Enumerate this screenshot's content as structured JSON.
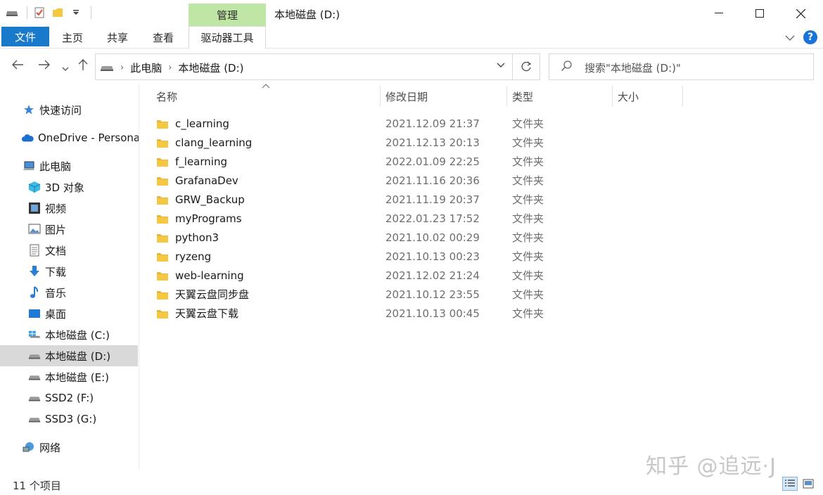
{
  "window": {
    "title": "本地磁盘 (D:)",
    "context_tab": "管理"
  },
  "ribbon": {
    "file": "文件",
    "home": "主页",
    "share": "共享",
    "view": "查看",
    "drive_tools": "驱动器工具"
  },
  "address": {
    "crumb1": "此电脑",
    "crumb2": "本地磁盘 (D:)"
  },
  "search": {
    "placeholder": "搜索\"本地磁盘 (D:)\""
  },
  "sidebar": {
    "items": [
      {
        "label": "快速访问",
        "icon": "star-icon"
      },
      {
        "label": "OneDrive - Personal",
        "icon": "cloud-icon"
      },
      {
        "label": "此电脑",
        "icon": "computer-icon"
      },
      {
        "label": "3D 对象",
        "icon": "cube-icon"
      },
      {
        "label": "视频",
        "icon": "film-icon"
      },
      {
        "label": "图片",
        "icon": "picture-icon"
      },
      {
        "label": "文档",
        "icon": "document-icon"
      },
      {
        "label": "下载",
        "icon": "download-icon"
      },
      {
        "label": "音乐",
        "icon": "music-icon"
      },
      {
        "label": "桌面",
        "icon": "desktop-icon"
      },
      {
        "label": "本地磁盘 (C:)",
        "icon": "windows-drive-icon"
      },
      {
        "label": "本地磁盘 (D:)",
        "icon": "drive-icon"
      },
      {
        "label": "本地磁盘 (E:)",
        "icon": "drive-icon"
      },
      {
        "label": "SSD2 (F:)",
        "icon": "drive-icon"
      },
      {
        "label": "SSD3 (G:)",
        "icon": "drive-icon"
      },
      {
        "label": "网络",
        "icon": "network-icon"
      }
    ]
  },
  "columns": {
    "name": "名称",
    "date": "修改日期",
    "type": "类型",
    "size": "大小"
  },
  "files": [
    {
      "name": "c_learning",
      "date": "2021.12.09 21:37",
      "type": "文件夹"
    },
    {
      "name": "clang_learning",
      "date": "2021.12.13 20:13",
      "type": "文件夹"
    },
    {
      "name": "f_learning",
      "date": "2022.01.09 22:25",
      "type": "文件夹"
    },
    {
      "name": "GrafanaDev",
      "date": "2021.11.16 20:36",
      "type": "文件夹"
    },
    {
      "name": "GRW_Backup",
      "date": "2021.11.19 20:37",
      "type": "文件夹"
    },
    {
      "name": "myPrograms",
      "date": "2022.01.23 17:52",
      "type": "文件夹"
    },
    {
      "name": "python3",
      "date": "2021.10.02 00:29",
      "type": "文件夹"
    },
    {
      "name": "ryzeng",
      "date": "2021.10.13 00:23",
      "type": "文件夹"
    },
    {
      "name": "web-learning",
      "date": "2021.12.02 21:24",
      "type": "文件夹"
    },
    {
      "name": "天翼云盘同步盘",
      "date": "2021.10.12 23:55",
      "type": "文件夹"
    },
    {
      "name": "天翼云盘下载",
      "date": "2021.10.13 00:45",
      "type": "文件夹"
    }
  ],
  "status": {
    "count": "11 个项目"
  },
  "watermark": "知乎 @追远·J",
  "colors": {
    "accent": "#1979ca",
    "manage_tab": "#bfe6a4",
    "selected_row": "#d9d9d9",
    "folder": "#f5c842"
  }
}
